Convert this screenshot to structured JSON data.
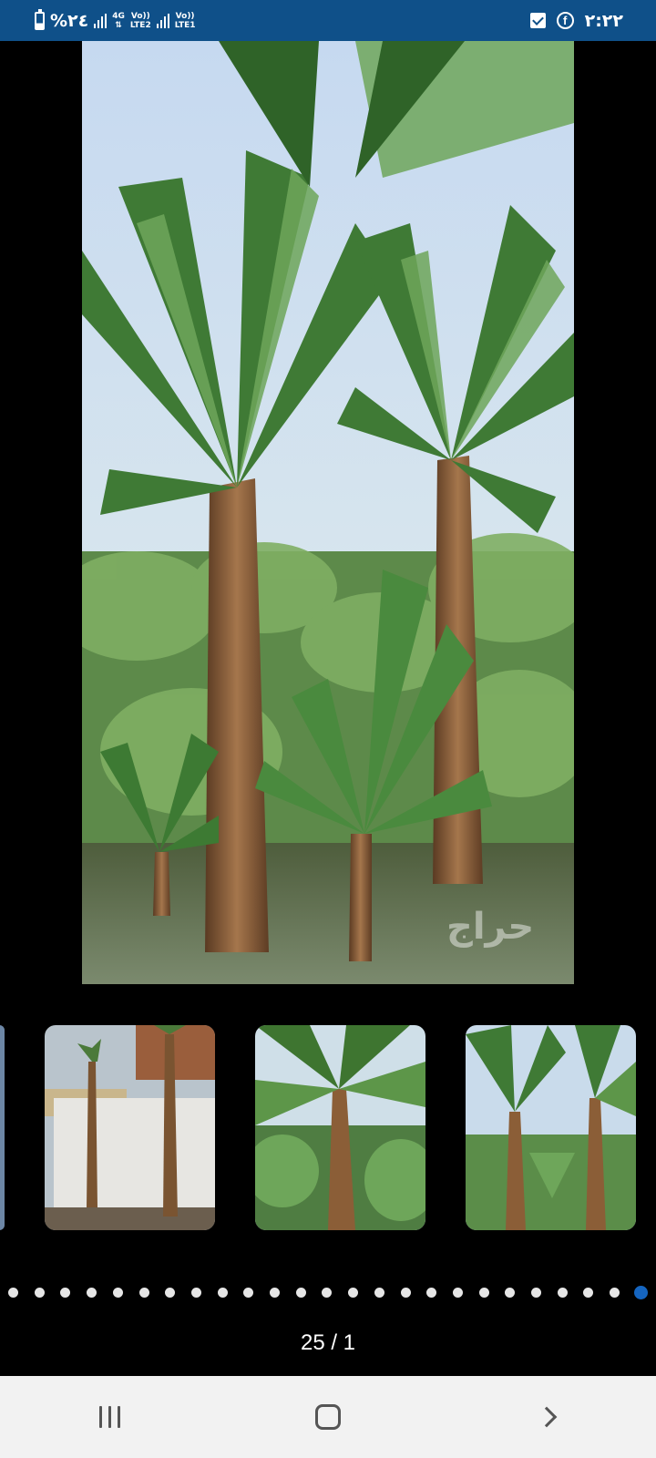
{
  "status_bar": {
    "battery_text": "%٢٤",
    "network1_top": "4G",
    "network1_bottom": "LTE2",
    "network2_top": "Vo))",
    "network2_bottom": "LTE1",
    "volte_top": "Vo))",
    "time": "٢:٢٢",
    "icons": [
      "battery-icon",
      "signal-icon",
      "checkbox-notification-icon",
      "facebook-icon"
    ]
  },
  "viewer": {
    "main_image": "palm-trees-photo",
    "thumbnails": [
      "palm-trees-building-thumb",
      "palm-trees-grove-thumb",
      "palm-trees-fan-thumb"
    ],
    "page_counter": "25 / 1",
    "dots_total": 25,
    "active_dot": 25
  },
  "nav_bar": {
    "icons": [
      "recents-icon",
      "home-icon",
      "back-icon"
    ]
  },
  "colors": {
    "status_bar": "#0f5089",
    "accent_dot": "#1565c0"
  }
}
